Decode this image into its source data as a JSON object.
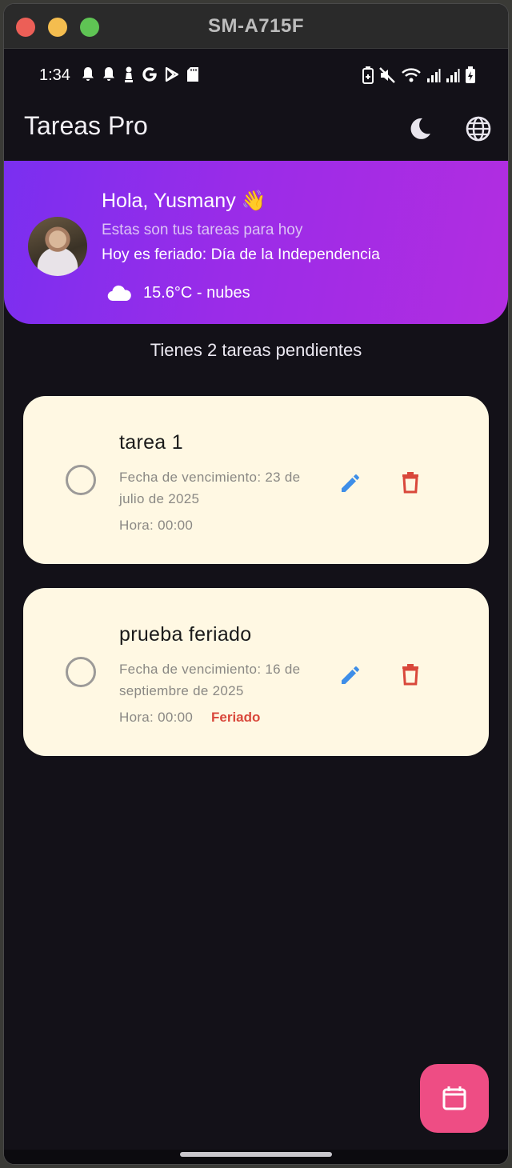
{
  "window": {
    "title": "SM-A715F"
  },
  "status_bar": {
    "time": "1:34",
    "left_icon_names": [
      "bell-icon",
      "bell-icon",
      "chess-pawn-icon",
      "google-g-icon",
      "play-store-icon",
      "sd-card-icon"
    ],
    "right_icon_names": [
      "battery-saver-icon",
      "mute-icon",
      "wifi-icon",
      "signal-icon",
      "signal-icon",
      "battery-icon"
    ]
  },
  "app_bar": {
    "title": "Tareas Pro",
    "theme_icon": "moon-icon",
    "language_icon": "globe-icon"
  },
  "header": {
    "greeting": "Hola, Yusmany 👋",
    "subtitle": "Estas son tus tareas para hoy",
    "holiday": "Hoy es feriado: Día de la Independencia",
    "weather_icon": "cloud-icon",
    "weather": "15.6°C - nubes"
  },
  "pending_text": "Tienes 2 tareas pendientes",
  "tasks": [
    {
      "title": "tarea 1",
      "due": "Fecha de vencimiento: 23 de julio de 2025",
      "hour": "Hora: 00:00",
      "tag": ""
    },
    {
      "title": "prueba feriado",
      "due": "Fecha de vencimiento: 16 de septiembre de 2025",
      "hour": "Hora: 00:00",
      "tag": "Feriado"
    }
  ],
  "fab": {
    "icon": "calendar-icon"
  },
  "colors": {
    "background": "#131118",
    "header_gradient_start": "#7a2ff0",
    "header_gradient_end": "#b22de0",
    "card": "#fff8e3",
    "edit": "#3e8ee8",
    "delete": "#d9483b",
    "fab": "#ee4d84"
  }
}
